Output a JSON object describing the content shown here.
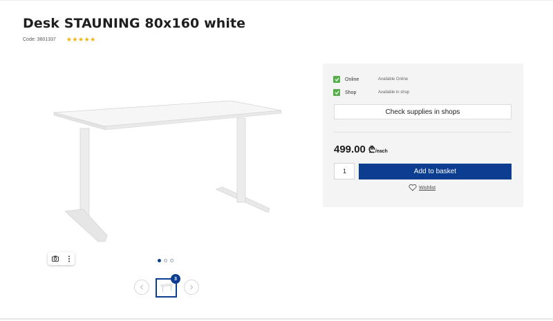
{
  "product": {
    "title": "Desk STAUNING 80x160 white",
    "code": "Code: 3601337",
    "rating_stars": 5
  },
  "gallery": {
    "image_icon": "desk-product-image",
    "tool_icons": [
      "camera-icon",
      "more-vertical-icon"
    ],
    "dots": 3,
    "active_dot": 1,
    "thumb_badge": "3"
  },
  "availability": [
    {
      "label": "Online",
      "status": "Available Online",
      "checked": true
    },
    {
      "label": "Shop",
      "status": "Available in shop",
      "checked": true
    }
  ],
  "actions": {
    "check_supplies": "Check supplies in shops",
    "add_to_basket": "Add to basket",
    "wishlist": "Wishlist"
  },
  "price": {
    "amount": "499.00",
    "currency": "₾",
    "unit": "/each"
  },
  "quantity": "1",
  "colors": {
    "accent": "#0b3d91",
    "check": "#56b04a",
    "star": "#f2b40c"
  }
}
